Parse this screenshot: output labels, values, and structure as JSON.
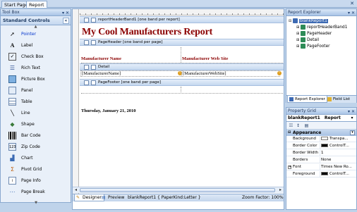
{
  "tabs": [
    {
      "label": "Start Page",
      "active": false
    },
    {
      "label": "Report",
      "active": true
    }
  ],
  "toolbox": {
    "title": "Tool Box",
    "section": "Standard Controls",
    "items": [
      {
        "label": "Pointer",
        "icon": "pointer-icon",
        "selected": true
      },
      {
        "label": "Label",
        "icon": "label-icon"
      },
      {
        "label": "Check Box",
        "icon": "checkbox-icon"
      },
      {
        "label": "Rich Text",
        "icon": "richtext-icon"
      },
      {
        "label": "Picture Box",
        "icon": "picturebox-icon"
      },
      {
        "label": "Panel",
        "icon": "panel-icon"
      },
      {
        "label": "Table",
        "icon": "table-icon"
      },
      {
        "label": "Line",
        "icon": "line-icon"
      },
      {
        "label": "Shape",
        "icon": "shape-icon"
      },
      {
        "label": "Bar Code",
        "icon": "barcode-icon"
      },
      {
        "label": "Zip Code",
        "icon": "zipcode-icon"
      },
      {
        "label": "Chart",
        "icon": "chart-icon"
      },
      {
        "label": "Pivot Grid",
        "icon": "pivotgrid-icon"
      },
      {
        "label": "Page Info",
        "icon": "pageinfo-icon"
      },
      {
        "label": "Page Break",
        "icon": "pagebreak-icon"
      }
    ]
  },
  "designer": {
    "bands": {
      "report_header": "reportHeaderBand1 [one band per report]",
      "page_header": "PageHeader [one band per page]",
      "detail": "Detail",
      "page_footer": "PageFooter [one band per page]"
    },
    "title_text": "My Cool Manufacturers Report",
    "col_manufacturer": "Manufacturer Name",
    "col_website": "Manufacturer Web Site",
    "field_manufacturer": "[ManufacturerName]",
    "field_website": "[ManufacturerWebSite]",
    "footer_date": "Thursday, January 21, 2010",
    "bottom": {
      "designer_tab": "Designer",
      "preview_tab": "Preview",
      "report_info": "blankReport1 { PaperKind:Letter }",
      "zoom": "Zoom Factor: 100%"
    }
  },
  "explorer": {
    "title": "Report Explorer",
    "tree": [
      {
        "label": "blankReport1",
        "level": 0,
        "selected": true,
        "color": "#3d6ab3"
      },
      {
        "label": "reportHeaderBand1",
        "level": 1,
        "color": "#2e8b57"
      },
      {
        "label": "PageHeader",
        "level": 1,
        "color": "#2e8b57"
      },
      {
        "label": "Detail",
        "level": 1,
        "color": "#2e8b57"
      },
      {
        "label": "PageFooter",
        "level": 1,
        "color": "#2e8b57"
      }
    ],
    "tab_explorer": "Report Explorer",
    "tab_fieldlist": "Field List"
  },
  "propgrid": {
    "title": "Property Grid",
    "object_name": "blankReport1",
    "object_type": "Report",
    "category": "Appearance",
    "rows": [
      {
        "name": "Background",
        "value": "Transpa...",
        "swatch": "#ffffff",
        "expandable": false
      },
      {
        "name": "Border Color",
        "value": "ControlT...",
        "swatch": "#000000",
        "expandable": false
      },
      {
        "name": "Border Width",
        "value": "1",
        "expandable": false
      },
      {
        "name": "Borders",
        "value": "None",
        "expandable": false
      },
      {
        "name": "Font",
        "value": "Times New Ro...",
        "expandable": true
      },
      {
        "name": "Foreground",
        "value": "ControlT...",
        "swatch": "#000000",
        "expandable": false
      }
    ]
  }
}
